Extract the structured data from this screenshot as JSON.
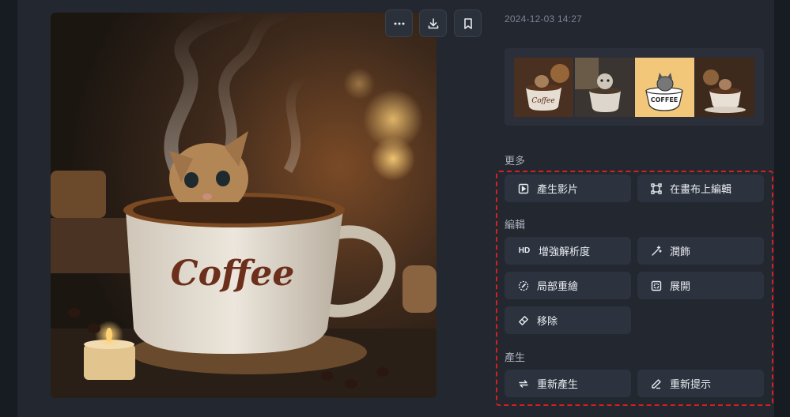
{
  "header": {
    "timestamp": "2024-12-03 14:27"
  },
  "image_actions": [
    {
      "icon": "more-icon"
    },
    {
      "icon": "download-icon"
    },
    {
      "icon": "bookmark-icon"
    }
  ],
  "main_image": {
    "cup_text": "Coffee"
  },
  "thumbnails": [
    {
      "caption": "Coffee"
    },
    {
      "caption": ""
    },
    {
      "caption": "COFFEE"
    },
    {
      "caption": ""
    }
  ],
  "sections": {
    "more": {
      "label": "更多",
      "buttons": [
        {
          "label": "產生影片",
          "icon": "video-plus-icon"
        },
        {
          "label": "在畫布上編輯",
          "icon": "canvas-edit-icon"
        }
      ]
    },
    "edit": {
      "label": "編輯",
      "buttons": [
        {
          "label": "增強解析度",
          "icon": "hd-icon",
          "icon_text": "HD"
        },
        {
          "label": "潤飾",
          "icon": "magic-wand-icon"
        },
        {
          "label": "局部重繪",
          "icon": "inpaint-brush-icon"
        },
        {
          "label": "展開",
          "icon": "expand-icon"
        },
        {
          "label": "移除",
          "icon": "eraser-icon"
        }
      ]
    },
    "generate": {
      "label": "產生",
      "buttons": [
        {
          "label": "重新產生",
          "icon": "regenerate-icon"
        },
        {
          "label": "重新提示",
          "icon": "pencil-icon"
        }
      ]
    }
  },
  "colors": {
    "highlight": "#d42020",
    "button_bg": "#2d333e",
    "panel_bg": "#222730"
  }
}
